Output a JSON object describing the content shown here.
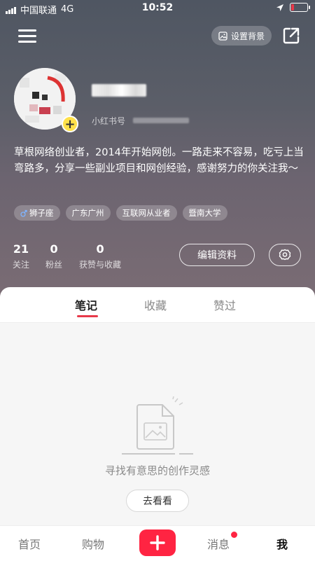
{
  "status_bar": {
    "carrier": "中国联通",
    "network": "4G",
    "time": "10:52"
  },
  "header": {
    "set_background_label": "设置背景"
  },
  "profile": {
    "rednote_id_label": "小红书号",
    "bio": "草根网络创业者，2014年开始网创。一路走来不容易，吃亏上当弯路多，分享一些副业项目和网创经验，感谢努力的你关注我～",
    "tags": [
      {
        "label": "狮子座",
        "icon": "male-icon"
      },
      {
        "label": "广东广州"
      },
      {
        "label": "互联网从业者"
      },
      {
        "label": "暨南大学"
      }
    ],
    "stats": {
      "following": {
        "value": "21",
        "label": "关注"
      },
      "followers": {
        "value": "0",
        "label": "粉丝"
      },
      "likes": {
        "value": "0",
        "label": "获赞与收藏"
      }
    },
    "edit_profile_label": "编辑资料"
  },
  "content_tabs": [
    {
      "label": "笔记",
      "active": true
    },
    {
      "label": "收藏",
      "active": false
    },
    {
      "label": "赞过",
      "active": false
    }
  ],
  "empty_state": {
    "text": "寻找有意思的创作灵感",
    "button_label": "去看看"
  },
  "bottom_nav": {
    "home": "首页",
    "shop": "购物",
    "messages": "消息",
    "me": "我"
  },
  "colors": {
    "accent": "#ff2442",
    "badge_yellow": "#ffe14a"
  }
}
